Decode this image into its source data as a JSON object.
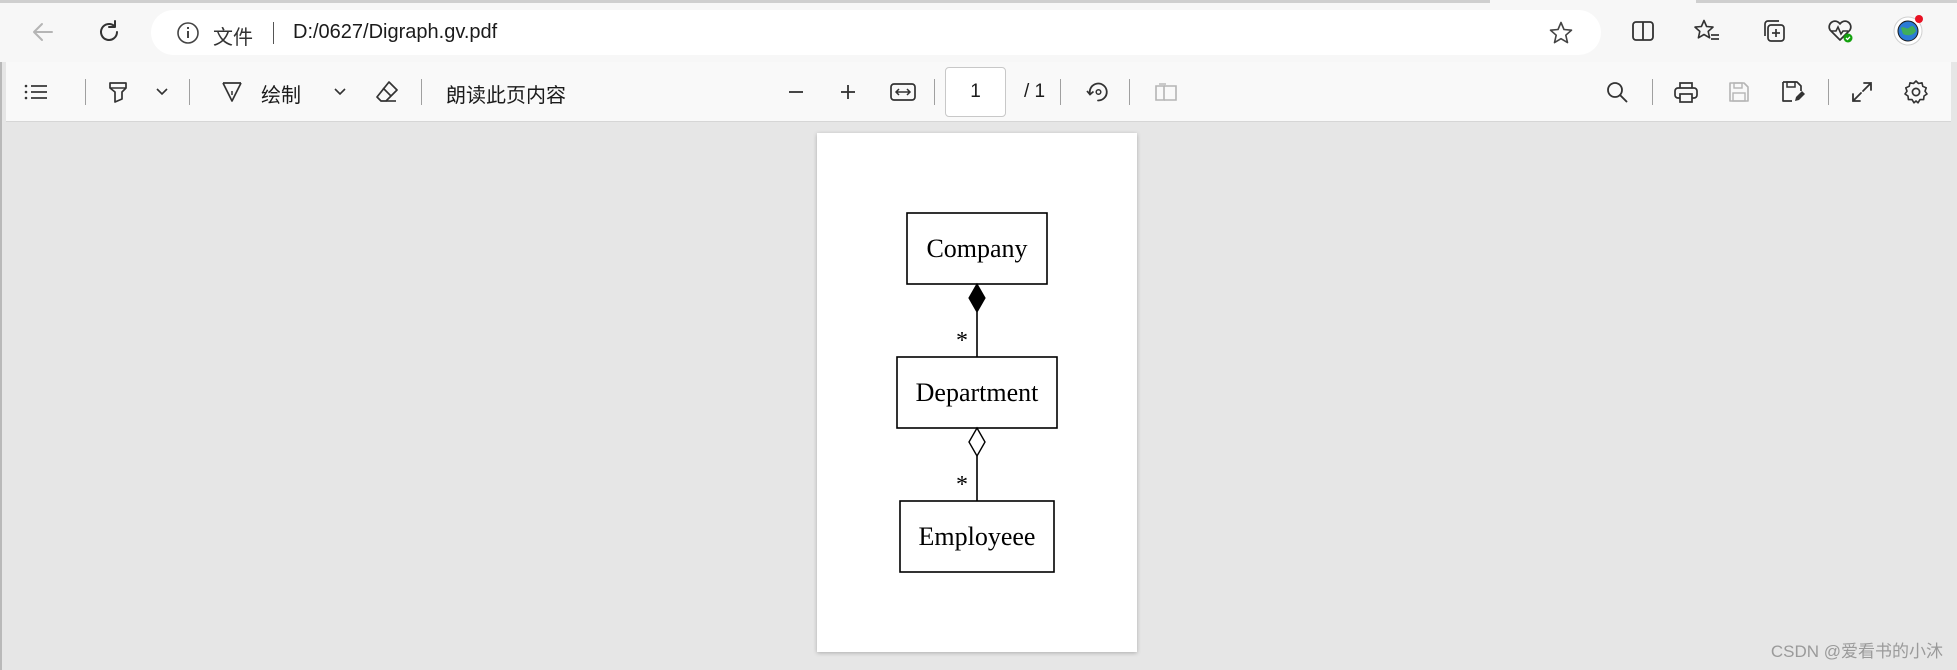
{
  "browser": {
    "address_label": "文件",
    "url": "D:/0627/Digraph.gv.pdf"
  },
  "pdf_toolbar": {
    "draw_label": "绘制",
    "read_aloud_label": "朗读此页内容",
    "page_number": "1",
    "page_total": "/ 1"
  },
  "document": {
    "nodes": {
      "company": "Company",
      "department": "Department",
      "employee": "Employeee"
    },
    "edges": {
      "company_department_multiplicity": "*",
      "department_employee_multiplicity": "*"
    }
  },
  "watermark": "CSDN @爱看书的小沐",
  "colors": {
    "toolbar_bg": "#f9f9f9",
    "viewer_bg": "#e6e6e6",
    "notification_dot": "#e81123",
    "health_badge": "#13a10e"
  },
  "icons": [
    "back-icon",
    "refresh-icon",
    "info-icon",
    "favorite-star-icon",
    "split-screen-icon",
    "favorites-icon",
    "collections-icon",
    "browser-essentials-icon",
    "profile-icon",
    "contents-icon",
    "highlight-icon",
    "chevron-down-icon",
    "draw-icon",
    "eraser-icon",
    "zoom-out-icon",
    "zoom-in-icon",
    "fit-width-icon",
    "rotate-icon",
    "page-view-icon",
    "search-icon",
    "print-icon",
    "save-icon",
    "save-as-icon",
    "fullscreen-icon",
    "settings-icon"
  ]
}
